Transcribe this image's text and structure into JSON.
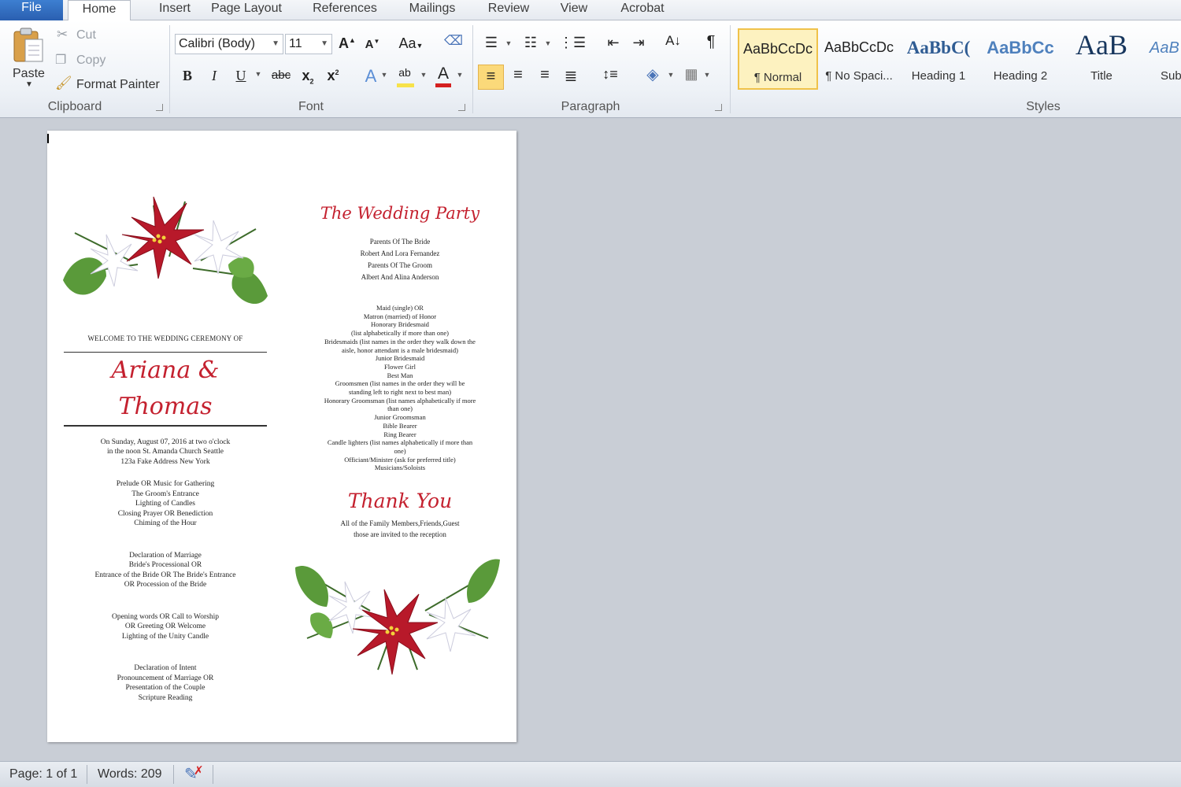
{
  "tabs": [
    "File",
    "Home",
    "Insert",
    "Page Layout",
    "References",
    "Mailings",
    "Review",
    "View",
    "Acrobat"
  ],
  "clipboard": {
    "paste": "Paste",
    "cut": "Cut",
    "copy": "Copy",
    "format_painter": "Format Painter",
    "label": "Clipboard"
  },
  "font": {
    "name": "Calibri (Body)",
    "size": "11",
    "change_case": "Aa",
    "label": "Font"
  },
  "paragraph": {
    "label": "Paragraph"
  },
  "styles": {
    "label": "Styles",
    "items": [
      {
        "sample": "AaBbCcDc",
        "name": "¶ Normal"
      },
      {
        "sample": "AaBbCcDc",
        "name": "¶ No Spaci..."
      },
      {
        "sample": "AaBbC(",
        "name": "Heading 1"
      },
      {
        "sample": "AaBbCc",
        "name": "Heading 2"
      },
      {
        "sample": "AaB",
        "name": "Title"
      },
      {
        "sample": "AaB",
        "name": "Sub"
      }
    ]
  },
  "colors": {
    "accent": "#c4212f",
    "highlight": "#f7e24a",
    "font_color": "#d42020"
  },
  "document": {
    "left": {
      "welcome": "WELCOME TO THE WEDDING CEREMONY OF",
      "names": "Ariana & Thomas",
      "details": [
        "On Sunday, August 07, 2016 at two o'clock",
        "in the noon St. Amanda Church Seattle",
        "123a Fake Address New York"
      ],
      "block1": [
        "Prelude OR Music for Gathering",
        "The Groom's Entrance",
        "Lighting of Candles",
        "Closing Prayer OR Benediction",
        "Chiming of the Hour"
      ],
      "block2": [
        "Declaration of Marriage",
        "Bride's Processional OR",
        "Entrance of the Bride OR The Bride's Entrance",
        "OR Procession of the Bride"
      ],
      "block3": [
        "Opening words OR Call to Worship",
        "OR Greeting OR Welcome",
        "Lighting of the Unity Candle"
      ],
      "block4": [
        "Declaration of Intent",
        "Pronouncement of Marriage OR",
        "Presentation of the Couple",
        "Scripture Reading"
      ]
    },
    "right": {
      "title": "The Wedding Party",
      "parents": [
        "Parents Of The Bride",
        "Robert And Lora Fernandez",
        "Parents Of The Groom",
        "Albert And Alina Anderson"
      ],
      "party": [
        "Maid (single) OR",
        "Matron (married) of Honor",
        "Honorary Bridesmaid",
        "(list alphabetically if more than one)",
        "Bridesmaids (list names in the order they walk down the",
        "aisle, honor attendant is a male bridesmaid)",
        "Junior Bridesmaid",
        "Flower Girl",
        "Best Man",
        "Groomsmen (list names in the order they will be",
        "standing left to right next to best man)",
        "Honorary Groomsman (list names alphabetically if more",
        "than one)",
        "Junior Groomsman",
        "Bible Bearer",
        "Ring Bearer",
        "Candle lighters (list names alphabetically if more than",
        "one)",
        "Officiant/Minister (ask for preferred title)",
        "Musicians/Soloists"
      ],
      "thanks_title": "Thank You",
      "thanks": [
        "All of the Family Members,Friends,Guest",
        "those are invited to the reception"
      ]
    }
  },
  "status": {
    "page": "Page: 1 of 1",
    "words": "Words: 209"
  }
}
